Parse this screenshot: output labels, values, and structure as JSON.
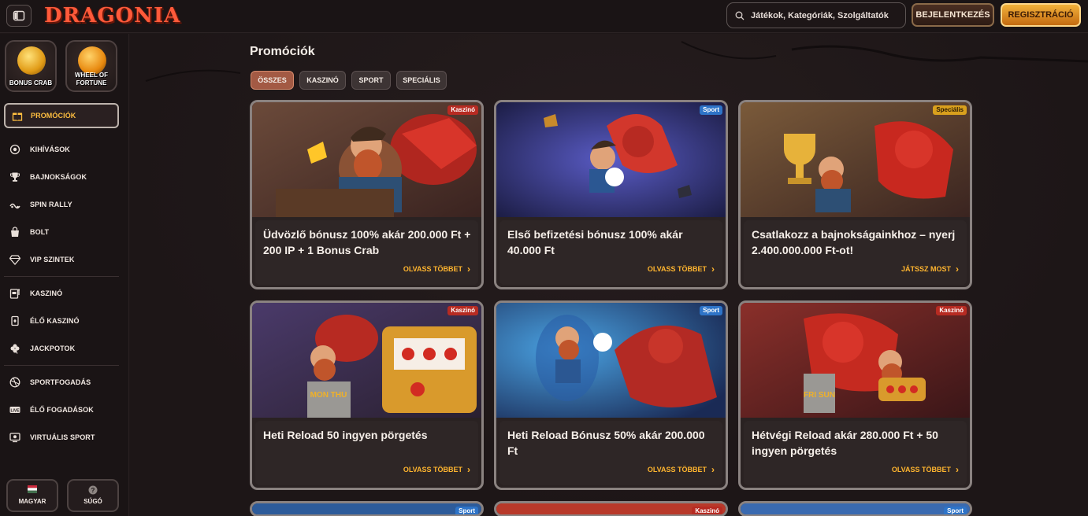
{
  "header": {
    "logo": "DRAGONIA",
    "search_placeholder": "Játékok, Kategóriák, Szolgáltatók",
    "login_label": "BEJELENTKEZÉS",
    "register_label": "REGISZTRÁCIÓ"
  },
  "sidebar": {
    "games": [
      {
        "label": "BONUS CRAB",
        "icon": "crab-icon"
      },
      {
        "label": "WHEEL OF FORTUNE",
        "icon": "wheel-icon"
      }
    ],
    "active": {
      "label": "PROMÓCIÓK",
      "icon": "gift-icon"
    },
    "items": [
      {
        "label": "KIHÍVÁSOK",
        "icon": "target-icon"
      },
      {
        "label": "BAJNOKSÁGOK",
        "icon": "trophy-icon"
      },
      {
        "label": "SPIN RALLY",
        "icon": "rally-icon"
      },
      {
        "label": "BOLT",
        "icon": "shop-icon"
      },
      {
        "label": "VIP SZINTEK",
        "icon": "diamond-icon"
      },
      {
        "label": "KASZINÓ",
        "icon": "slot-icon"
      },
      {
        "label": "ÉLŐ KASZINÓ",
        "icon": "cards-icon"
      },
      {
        "label": "JACKPOTOK",
        "icon": "clover-icon"
      },
      {
        "label": "SPORTFOGADÁS",
        "icon": "ball-icon"
      },
      {
        "label": "ÉLŐ FOGADÁSOK",
        "icon": "live-icon"
      },
      {
        "label": "VIRTUÁLIS SPORT",
        "icon": "virtual-icon"
      }
    ],
    "language_label": "MAGYAR",
    "help_label": "SÚGÓ"
  },
  "main": {
    "title": "Promóciók",
    "filters": [
      "ÖSSZES",
      "KASZINÓ",
      "SPORT",
      "SPECIÁLIS"
    ],
    "active_filter": "ÖSSZES",
    "cards": [
      {
        "badge": "Kaszinó",
        "badge_type": "kaszino",
        "title": "Üdvözlő bónusz 100% akár 200.000 Ft + 200 IP + 1 Bonus Crab",
        "action": "OLVASS TÖBBET"
      },
      {
        "badge": "Sport",
        "badge_type": "sport",
        "title": "Első befizetési bónusz 100% akár 40.000 Ft",
        "action": "OLVASS TÖBBET"
      },
      {
        "badge": "Speciális",
        "badge_type": "specialis",
        "title": "Csatlakozz a bajnokságainkhoz – nyerj 2.400.000.000 Ft-ot!",
        "action": "JÁTSSZ MOST"
      },
      {
        "badge": "Kaszinó",
        "badge_type": "kaszino",
        "title": "Heti Reload 50 ingyen pörgetés",
        "action": "OLVASS TÖBBET"
      },
      {
        "badge": "Sport",
        "badge_type": "sport",
        "title": "Heti Reload Bónusz 50% akár 200.000 Ft",
        "action": "OLVASS TÖBBET"
      },
      {
        "badge": "Kaszinó",
        "badge_type": "kaszino",
        "title": "Hétvégi Reload akár 280.000 Ft + 50 ingyen pörgetés",
        "action": "OLVASS TÖBBET"
      }
    ],
    "next_row_badges": [
      "Sport",
      "Kaszinó",
      "Sport"
    ],
    "image_text": {
      "card4_sign": "MON THU",
      "card6_sign": "FRI SUN"
    }
  }
}
